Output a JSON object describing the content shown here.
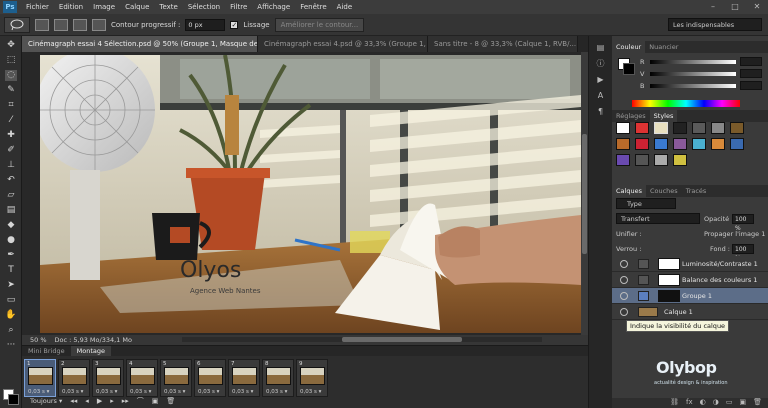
{
  "app": {
    "logo": "Ps"
  },
  "menu": [
    "Fichier",
    "Edition",
    "Image",
    "Calque",
    "Texte",
    "Sélection",
    "Filtre",
    "Affichage",
    "Fenêtre",
    "Aide"
  ],
  "window_buttons": [
    "–",
    "□",
    "✕"
  ],
  "options": {
    "contour_label": "Contour progressif :",
    "contour_value": "0 px",
    "lissage_label": "Lissage",
    "lissage_checked": "✓",
    "refine_button": "Améliorer le contour...",
    "workspace": "Les indispensables"
  },
  "doc_tabs": [
    {
      "label": "Cinémagraph essai 4 Sélection.psd @ 50% (Groupe 1, Masque de fusion/8) *  ×",
      "active": true
    },
    {
      "label": "Cinémagraph essai 4.psd @ 33,3% (Groupe 1, RVB/...",
      "active": false
    },
    {
      "label": "Sans titre - 8 @ 33,3% (Calque 1, RVB/...",
      "active": false
    }
  ],
  "status": {
    "zoom": "50 %",
    "doc": "Doc : 5,93 Mo/334,1 Mo"
  },
  "photo": {
    "brand": "Olyos",
    "tagline": "Agence Web Nantes"
  },
  "timeline": {
    "tabs": [
      "Mini Bridge",
      "Montage"
    ],
    "frames": [
      {
        "num": "1",
        "delay": "0,03 s ▾"
      },
      {
        "num": "2",
        "delay": "0,03 s ▾"
      },
      {
        "num": "3",
        "delay": "0,03 s ▾"
      },
      {
        "num": "4",
        "delay": "0,03 s ▾"
      },
      {
        "num": "5",
        "delay": "0,03 s ▾"
      },
      {
        "num": "6",
        "delay": "0,03 s ▾"
      },
      {
        "num": "7",
        "delay": "0,03 s ▾"
      },
      {
        "num": "8",
        "delay": "0,03 s ▾"
      },
      {
        "num": "9",
        "delay": "0,03 s ▾"
      }
    ],
    "loop": "Toujours ▾",
    "controls": [
      "◂◂",
      "◂",
      "▶",
      "▸",
      "▸▸",
      "⌒",
      "▣",
      "🗑"
    ]
  },
  "color_panel": {
    "tabs": [
      "Couleur",
      "Nuancier"
    ],
    "r_label": "R",
    "g_label": "V",
    "b_label": "B"
  },
  "styles_panel": {
    "tabs": [
      "Réglages",
      "Styles"
    ]
  },
  "layers_panel": {
    "tabs": [
      "Calques",
      "Couches",
      "Tracés"
    ],
    "filter": "Type",
    "blend": "Transfert",
    "opacity_label": "Opacité :",
    "opacity_value": "100 %",
    "unify_label": "Unifier :",
    "propagate_label": "Propager l'image 1",
    "lock_label": "Verrou :",
    "fill_label": "Fond :",
    "fill_value": "100 %",
    "layers": [
      {
        "name": "Luminosité/Contraste 1",
        "active": false
      },
      {
        "name": "Balance des couleurs 1",
        "active": false
      },
      {
        "name": "Groupe 1",
        "active": true
      },
      {
        "name": "Calque 1",
        "active": false
      }
    ],
    "tooltip": "Indique la visibilité du calque",
    "footer": [
      "⛓",
      "fx",
      "◐",
      "◑",
      "▭",
      "▣",
      "🗑"
    ]
  },
  "logo": {
    "main": "Olybop",
    "sub": "actualité design & inspiration"
  },
  "colors": {
    "accent": "#5c6d88",
    "panel": "#3a3a3a",
    "bg": "#2b2b2b"
  }
}
